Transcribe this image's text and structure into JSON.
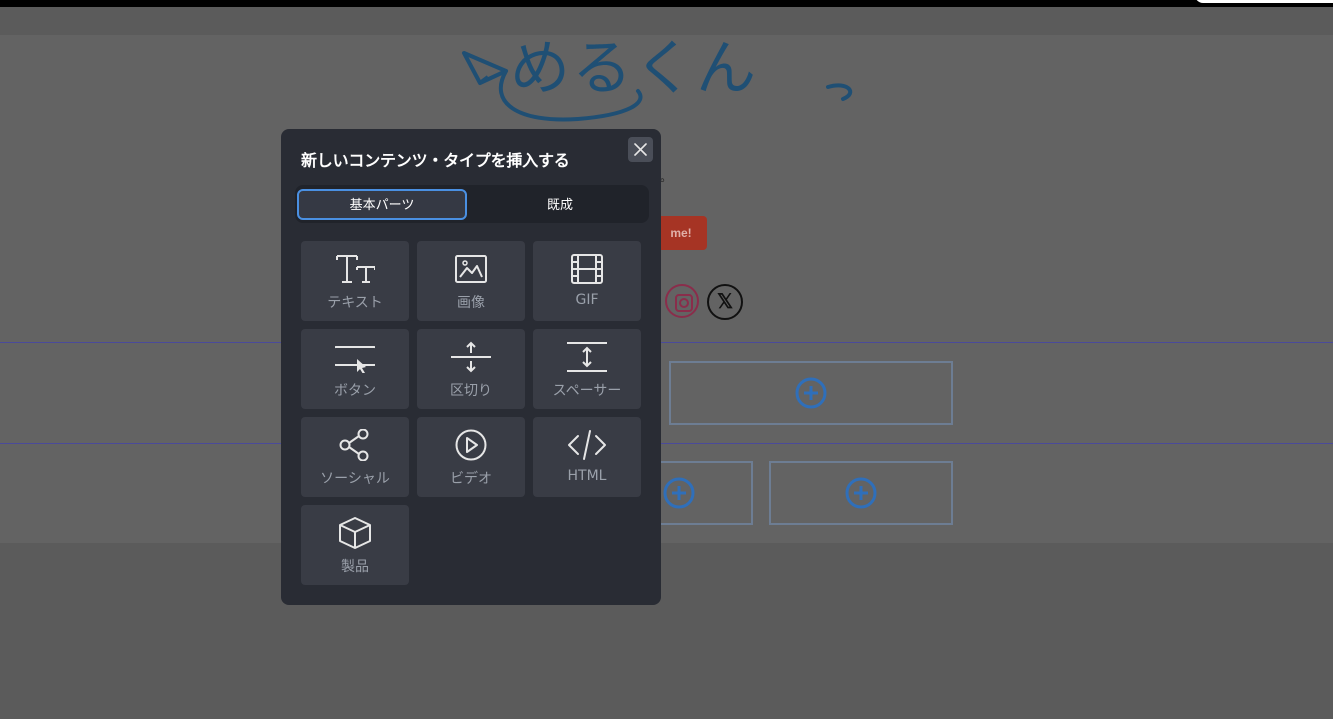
{
  "app": {
    "logo_text": "めるくん"
  },
  "background": {
    "fragment_text": "。",
    "red_button_label": "me!",
    "x_label": "𝕏"
  },
  "modal": {
    "title": "新しいコンテンツ・タイプを挿入する",
    "close_icon": "close-icon",
    "tabs": [
      {
        "label": "基本パーツ",
        "active": true
      },
      {
        "label": "既成",
        "active": false
      }
    ],
    "tiles": [
      {
        "label": "テキスト",
        "icon": "text-icon"
      },
      {
        "label": "画像",
        "icon": "image-icon"
      },
      {
        "label": "GIF",
        "icon": "gif-icon"
      },
      {
        "label": "ボタン",
        "icon": "button-icon"
      },
      {
        "label": "区切り",
        "icon": "divider-icon"
      },
      {
        "label": "スペーサー",
        "icon": "spacer-icon"
      },
      {
        "label": "ソーシャル",
        "icon": "social-icon"
      },
      {
        "label": "ビデオ",
        "icon": "video-icon"
      },
      {
        "label": "HTML",
        "icon": "html-icon"
      },
      {
        "label": "製品",
        "icon": "product-icon"
      }
    ]
  },
  "colors": {
    "overlay": "#5b5b5b",
    "modal_bg": "#292c34",
    "tile_bg": "#393c45",
    "accent": "#4a90e2",
    "logo": "#1f4f74"
  }
}
